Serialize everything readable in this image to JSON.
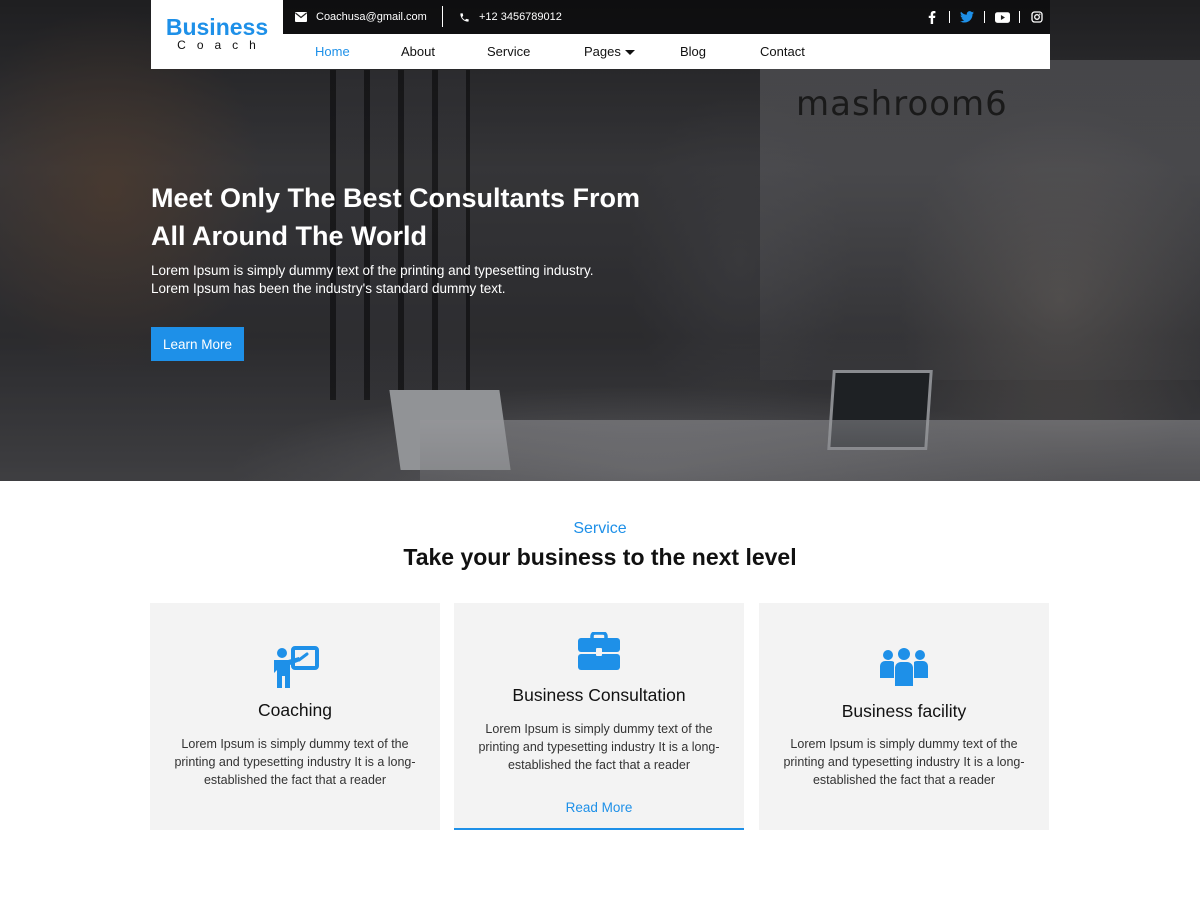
{
  "brand": {
    "name": "Business",
    "tagline": "Coach"
  },
  "topbar": {
    "email": "Coachusa@gmail.com",
    "phone": "+12 3456789012",
    "socials": [
      "facebook-icon",
      "twitter-icon",
      "youtube-icon",
      "instagram-icon"
    ]
  },
  "nav": {
    "items": [
      {
        "label": "Home",
        "active": true
      },
      {
        "label": "About"
      },
      {
        "label": "Service"
      },
      {
        "label": "Pages"
      },
      {
        "label": "Blog"
      },
      {
        "label": "Contact"
      }
    ]
  },
  "hero": {
    "title_line1": "Meet Only The Best Consultants From",
    "title_line2": "All Around The World",
    "text_line1": "Lorem Ipsum is simply dummy text of the printing and typesetting industry.",
    "text_line2": "Lorem Ipsum has been the industry's standard dummy text.",
    "button": "Learn More",
    "wall_sign": "mashroom6"
  },
  "services": {
    "kicker": "Service",
    "title": "Take your business to the next level",
    "cards": [
      {
        "icon": "presentation-icon",
        "title": "Coaching",
        "text": "Lorem Ipsum is simply dummy text of the printing and typesetting industry It is a long-established the fact that a reader"
      },
      {
        "icon": "briefcase-icon",
        "title": "Business Consultation",
        "text": "Lorem Ipsum is simply dummy text of the printing and typesetting industry It is a long-established the fact that a reader",
        "link": "Read More"
      },
      {
        "icon": "team-icon",
        "title": "Business facility",
        "text": "Lorem Ipsum is simply dummy text of the printing and typesetting industry It is a long-established the fact that a reader"
      }
    ]
  },
  "colors": {
    "accent": "#1e90e8",
    "card_bg": "#f3f3f3",
    "text": "#111111"
  }
}
